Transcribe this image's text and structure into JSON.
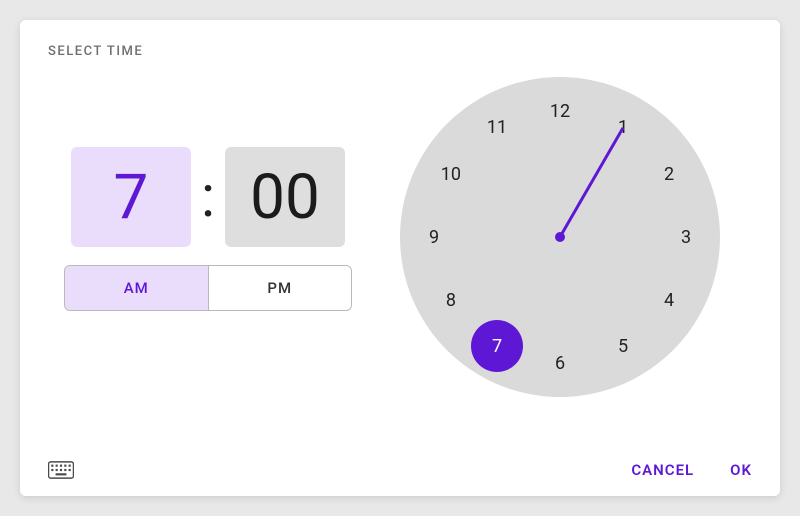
{
  "title": "SELECT TIME",
  "time": {
    "hour": "7",
    "minute": "00",
    "separator": ":"
  },
  "period": {
    "am": "AM",
    "pm": "PM",
    "selected": "AM"
  },
  "clock": {
    "numbers": [
      "12",
      "1",
      "2",
      "3",
      "4",
      "5",
      "6",
      "7",
      "8",
      "9",
      "10",
      "11"
    ],
    "selected_hour": 7,
    "radius": 126
  },
  "actions": {
    "cancel": "CANCEL",
    "ok": "OK"
  },
  "colors": {
    "accent": "#5f17d6",
    "accent_bg": "#eadcfb",
    "clock_face": "#dadada",
    "neutral_bg": "#dedede"
  }
}
